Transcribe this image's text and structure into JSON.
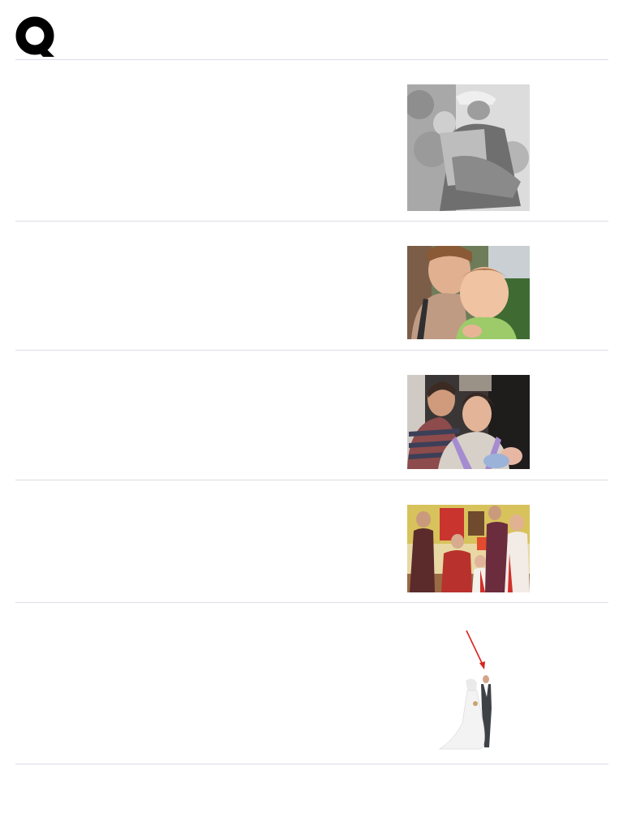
{
  "app": {
    "logo_icon": "q-logo-icon",
    "divider_color": "#dcdde6"
  },
  "feed": {
    "items": [
      {
        "image_icon": "photo-grandfather-child-bw"
      },
      {
        "image_icon": "photo-mother-baby"
      },
      {
        "image_icon": "photo-parents-newborn"
      },
      {
        "image_icon": "photo-family-gathering"
      },
      {
        "image_icon": "photo-bride-groom-arrow"
      }
    ]
  }
}
